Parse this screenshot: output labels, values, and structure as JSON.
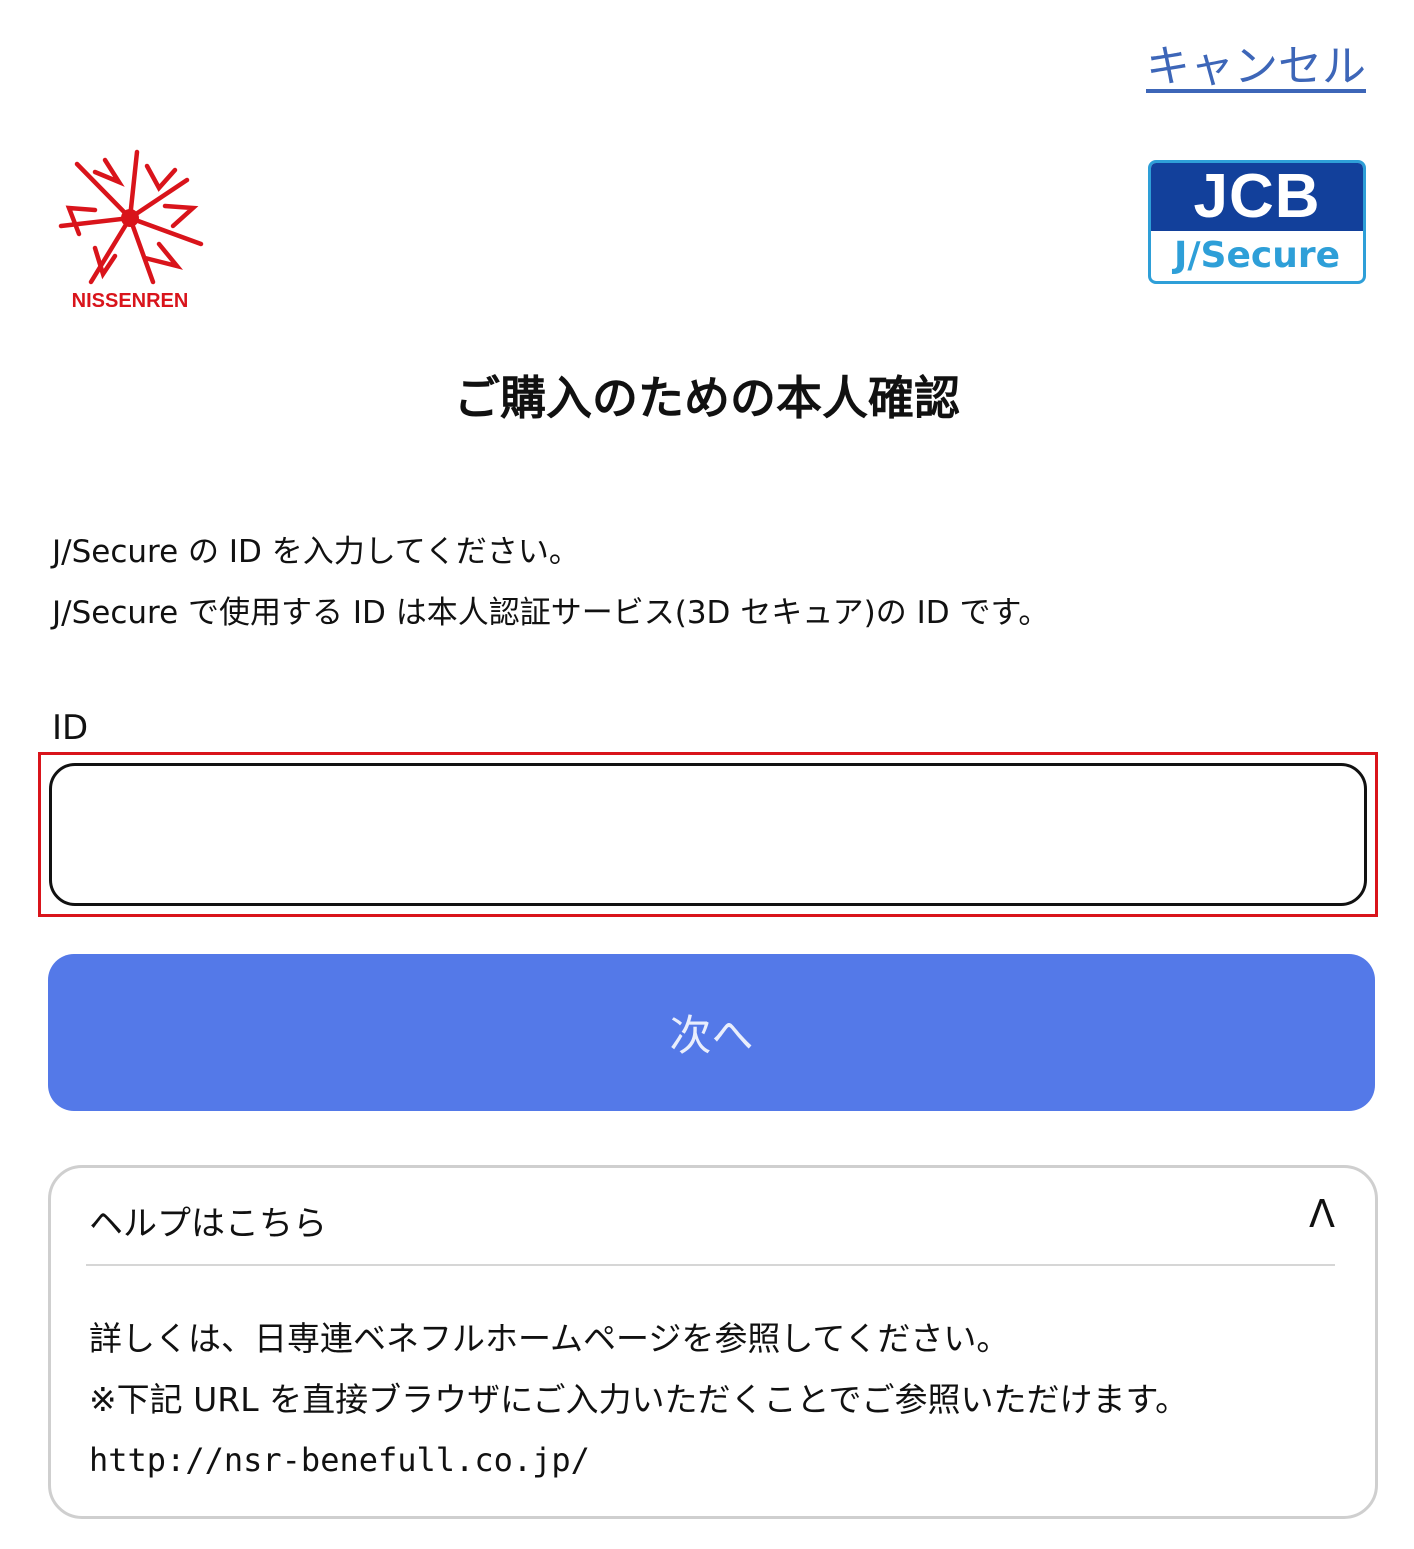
{
  "header": {
    "cancel_label": "キャンセル"
  },
  "logos": {
    "nissenren_text": "NISSENREN",
    "jcb_top": "JCB",
    "jcb_bottom": "J/Secure"
  },
  "main": {
    "title": "ご購入のための本人確認",
    "description_line1": "J/Secure の ID を入力してください。",
    "description_line2": "J/Secure で使用する ID は本人認証サービス(3D セキュア)の ID です。",
    "id_label": "ID",
    "id_value": "",
    "next_label": "次へ"
  },
  "help": {
    "title": "ヘルプはこちら",
    "toggle_symbol": "Λ",
    "line1": "詳しくは、日専連ベネフルホームページを参照してください。",
    "line2": "※下記 URL を直接ブラウザにご入力いただくことでご参照いただけます。",
    "url": "http://nsr-benefull.co.jp/"
  },
  "colors": {
    "brand_red": "#d9141b",
    "jcb_navy": "#12409b",
    "jcb_cyan": "#2e9fd8",
    "button_blue": "#5479e8",
    "link_blue": "#3d66b8"
  }
}
